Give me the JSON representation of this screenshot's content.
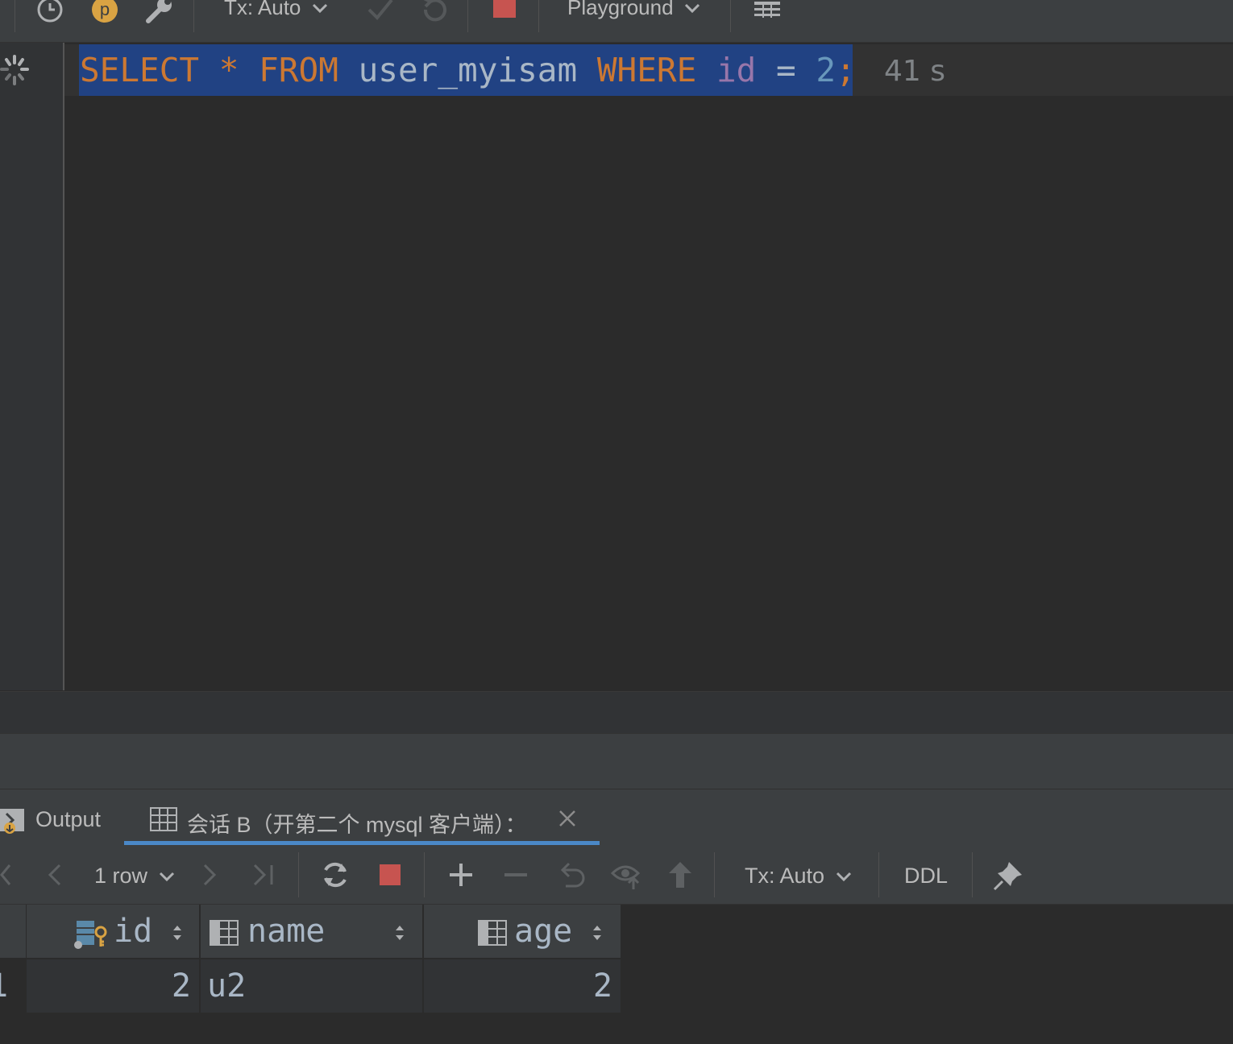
{
  "toolbar": {
    "tx_mode": "Tx: Auto",
    "schema": "Playground",
    "icons": [
      "history-icon",
      "p-icon",
      "wrench-icon",
      "commit-check-icon",
      "rollback-icon",
      "stop-icon",
      "table-icon"
    ]
  },
  "editor": {
    "sql": {
      "kw_select": "SELECT",
      "star": "*",
      "kw_from": "FROM",
      "table": "user_myisam",
      "kw_where": "WHERE",
      "column": "id",
      "op": "=",
      "value": "2",
      "semicolon": ";"
    },
    "elapsed": "41 s"
  },
  "tabs": {
    "output": "Output",
    "session": "会话 B（开第二个 mysql 客户端）："
  },
  "result_toolbar": {
    "rows": "1 row",
    "tx_mode": "Tx: Auto",
    "ddl": "DDL"
  },
  "grid": {
    "columns": [
      "id",
      "name",
      "age"
    ],
    "rows": [
      {
        "row_num": "1",
        "id": "2",
        "name": "u2",
        "age": "2"
      }
    ]
  },
  "colors": {
    "selection": "#214283",
    "keyword": "#cc7832",
    "identifier": "#a9b7c6",
    "column": "#9876aa",
    "number": "#6897bb",
    "stop": "#c75450",
    "tab_underline": "#4a88c7"
  }
}
